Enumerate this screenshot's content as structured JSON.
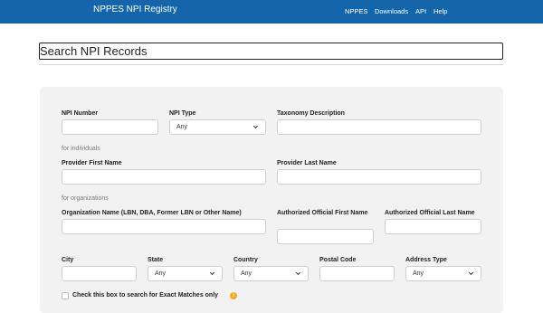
{
  "header": {
    "brand": "NPPES NPI Registry",
    "nav": [
      "NPPES",
      "Downloads",
      "API",
      "Help"
    ]
  },
  "page": {
    "title": "Search NPI Records"
  },
  "form": {
    "npi_number_label": "NPI Number",
    "npi_type_label": "NPI Type",
    "npi_type_value": "Any",
    "taxonomy_label": "Taxonomy Description",
    "individuals_heading": "for individuals",
    "first_name_label": "Provider First Name",
    "last_name_label": "Provider Last Name",
    "organizations_heading": "for organizations",
    "org_name_label": "Organization Name (LBN, DBA, Former LBN or Other Name)",
    "auth_first_label": "Authorized Official First Name",
    "auth_last_label": "Authorized Official Last Name",
    "city_label": "City",
    "state_label": "State",
    "state_value": "Any",
    "country_label": "Country",
    "country_value": "Any",
    "postal_label": "Postal Code",
    "address_type_label": "Address Type",
    "address_type_value": "Any",
    "exact_match_label": "Check this box to search for Exact Matches only",
    "info_glyph": "i"
  },
  "colors": {
    "header_bg": "#1565ab",
    "panel_bg": "#f2f2f2",
    "info_badge": "#f0a920"
  }
}
